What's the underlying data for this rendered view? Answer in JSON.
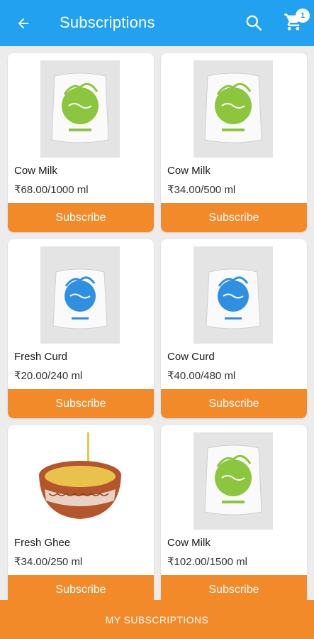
{
  "header": {
    "title": "Subscriptions",
    "cart_count": "1",
    "bg_color": "#21a1f0"
  },
  "products": [
    {
      "name": "Cow Milk",
      "price": "₹68.00/1000 ml",
      "button": "Subscribe",
      "image": "green-milk-pouch"
    },
    {
      "name": "Cow Milk",
      "price": "₹34.00/500 ml",
      "button": "Subscribe",
      "image": "green-milk-pouch"
    },
    {
      "name": "Fresh Curd",
      "price": "₹20.00/240 ml",
      "button": "Subscribe",
      "image": "blue-curd-pouch"
    },
    {
      "name": "Cow Curd",
      "price": "₹40.00/480 ml",
      "button": "Subscribe",
      "image": "blue-curd-pouch"
    },
    {
      "name": "Fresh Ghee",
      "price": "₹34.00/250 ml",
      "button": "Subscribe",
      "image": "ghee-bowl"
    },
    {
      "name": "Cow Milk",
      "price": "₹102.00/1500 ml",
      "button": "Subscribe",
      "image": "green-milk-pouch"
    }
  ],
  "footer": {
    "label": "MY SUBSCRIPTIONS"
  },
  "colors": {
    "accent": "#f28a2a",
    "primary": "#21a1f0"
  }
}
